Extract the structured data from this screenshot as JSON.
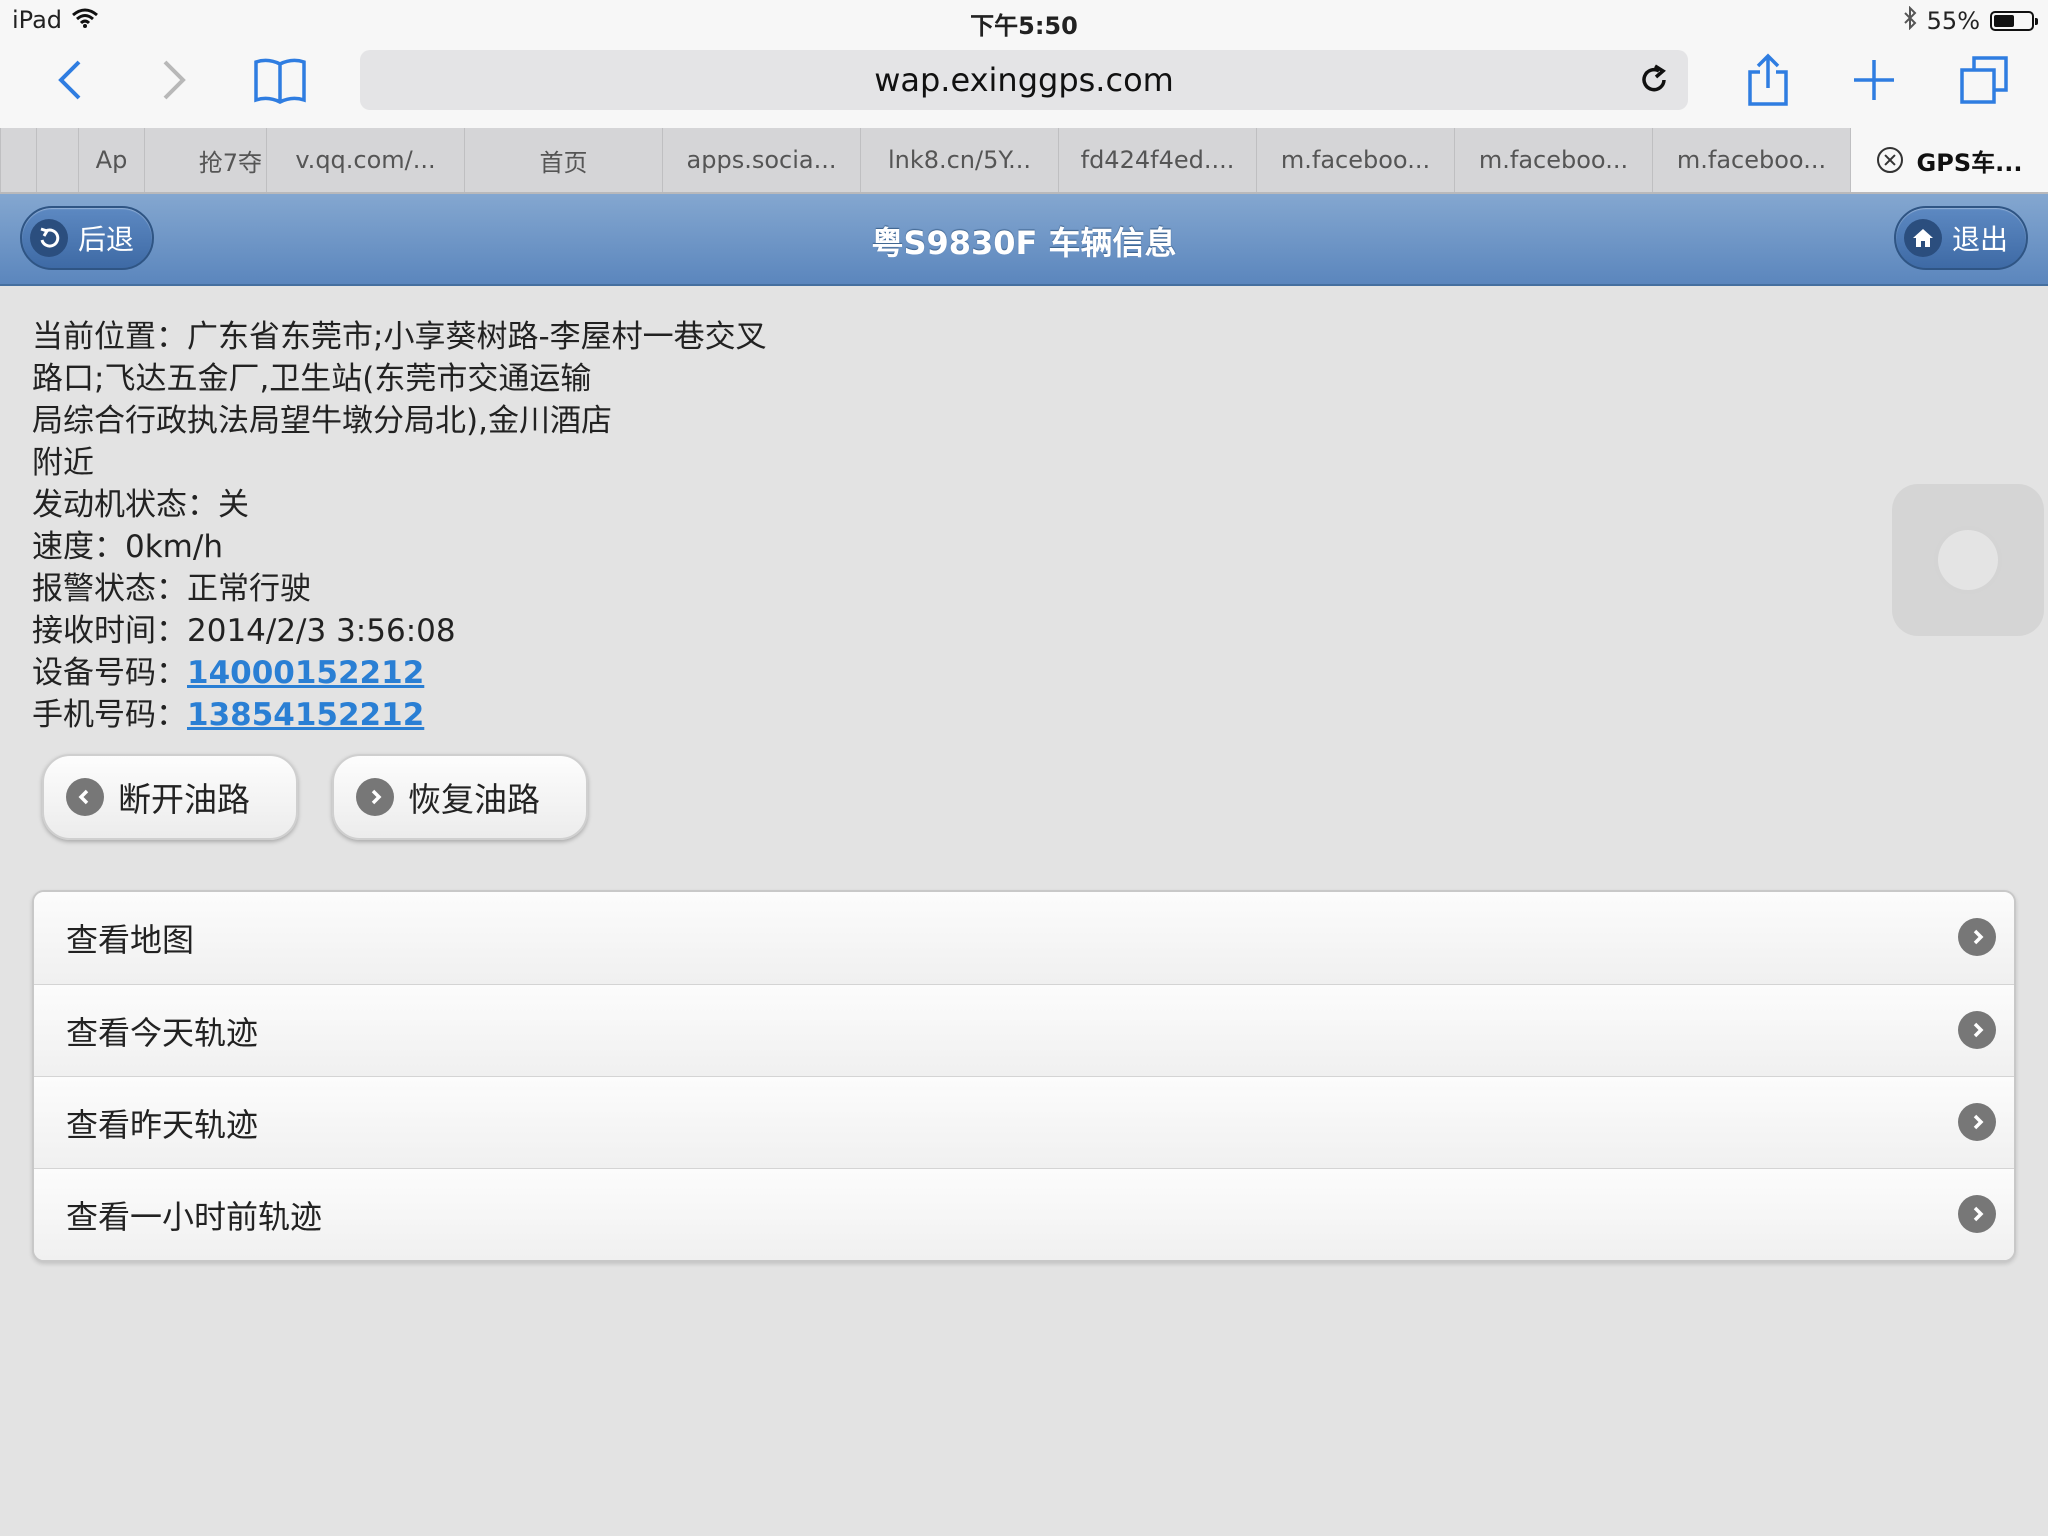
{
  "status_bar": {
    "device": "iPad",
    "time": "下午5:50",
    "battery": "55%",
    "battery_level": 0.55
  },
  "browser": {
    "url": "wap.exinggps.com",
    "tabs": [
      {
        "label": ""
      },
      {
        "label": "Ap"
      },
      {
        "label": "抢7夺"
      },
      {
        "label": "v.qq.com/..."
      },
      {
        "label": "首页"
      },
      {
        "label": "apps.socia..."
      },
      {
        "label": "lnk8.cn/5Y..."
      },
      {
        "label": "fd424f4ed...."
      },
      {
        "label": "m.faceboo..."
      },
      {
        "label": "m.faceboo..."
      },
      {
        "label": "m.faceboo..."
      },
      {
        "label": "GPS车..."
      }
    ]
  },
  "header": {
    "title": "粤S9830F 车辆信息",
    "back_label": "后退",
    "exit_label": "退出",
    "accent": "#5b86bd"
  },
  "info": {
    "location_label": "当前位置：",
    "location_line1": "广东省东莞市;小享葵树路-李屋村一巷交叉",
    "location_line2": "路口;飞达五金厂,卫生站(东莞市交通运输",
    "location_line3": "局综合行政执法局望牛墩分局北),金川酒店",
    "location_line4": "附近",
    "engine_label": "发动机状态：",
    "engine_value": "关",
    "speed_label": "速度：",
    "speed_value": "0km/h",
    "alarm_label": "报警状态：",
    "alarm_value": "正常行驶",
    "time_label": "接收时间：",
    "time_value": "2014/2/3 3:56:08",
    "device_label": "设备号码：",
    "device_value": "14000152212",
    "phone_label": "手机号码：",
    "phone_value": "13854152212",
    "link_color": "#2a7fd4"
  },
  "buttons": {
    "cut_oil": "断开油路",
    "restore_oil": "恢复油路"
  },
  "menu": {
    "items": [
      {
        "label": "查看地图"
      },
      {
        "label": "查看今天轨迹"
      },
      {
        "label": "查看昨天轨迹"
      },
      {
        "label": "查看一小时前轨迹"
      }
    ]
  }
}
